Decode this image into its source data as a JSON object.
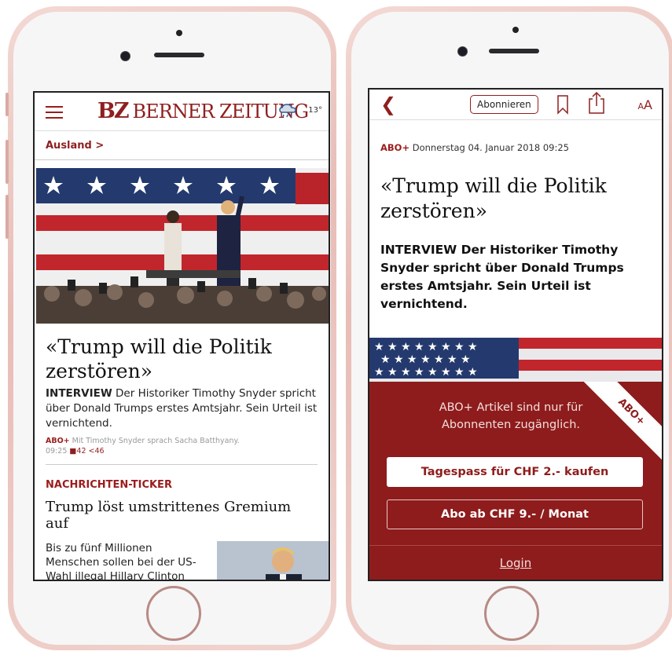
{
  "colors": {
    "brand_red": "#8f1f1f",
    "paywall_red": "#8e1c1c",
    "phone_rose": "#e8bdb6"
  },
  "left": {
    "header": {
      "logo_bz": "BZ",
      "logo_text": "BERNER ZEITUNG",
      "weather_icon": "cloud-rain-icon",
      "temperature": "13°"
    },
    "section": "Ausland >",
    "article": {
      "headline": "«Trump will die Politik zerstören»",
      "lead_prefix": "INTERVIEW",
      "lead": " Der Historiker Timothy Snyder spricht über Donald Trumps erstes Amtsjahr. Sein Urteil ist vernichtend.",
      "abo_label": "ABO+",
      "byline": " Mit Timothy Snyder sprach Sacha Batthyany.",
      "time": "09:25",
      "comments": "42",
      "shares": "46"
    },
    "ticker": {
      "label": "NACHRICHTEN-TICKER",
      "headline": "Trump löst umstrittenes Gremium auf",
      "text": "Bis zu fünf Millionen Menschen sollen bei der US-Wahl illegal Hillary Clinton"
    }
  },
  "right": {
    "toolbar": {
      "subscribe": "Abonnieren",
      "font_size_small": "A",
      "font_size_large": "A"
    },
    "date_abo": "ABO+",
    "date": " Donnerstag 04. Januar 2018 09:25",
    "headline": "«Trump will die Politik zerstören»",
    "lead": "INTERVIEW Der Historiker Timothy Snyder spricht über Donald Trumps erstes Amtsjahr. Sein Urteil ist vernichtend.",
    "paywall": {
      "message": "ABO+ Artikel sind nur für Abonnenten zugänglich.",
      "ribbon": "ABO+",
      "day_pass": "Tagespass für CHF 2.- kaufen",
      "subscription": "Abo ab CHF 9.- / Monat",
      "login": "Login"
    }
  }
}
